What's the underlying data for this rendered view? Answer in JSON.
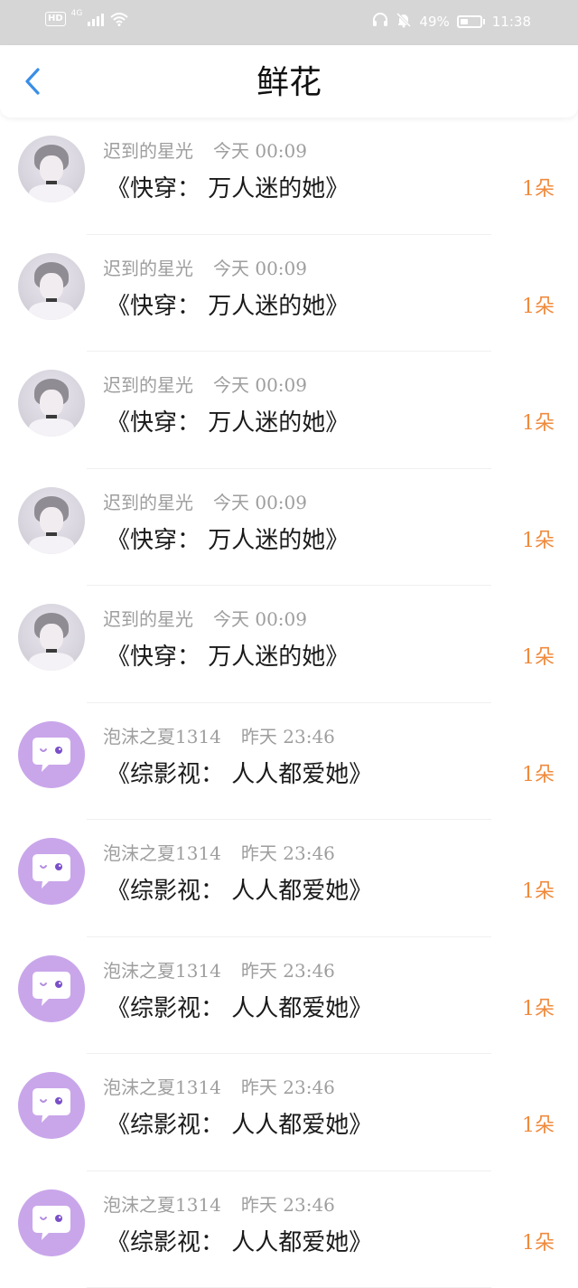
{
  "status_bar": {
    "hd": "HD",
    "network": "4G",
    "battery_percent": "49%",
    "battery_level": 0.49,
    "time": "11:38",
    "icons": [
      "signal-icon",
      "wifi-icon",
      "headphones-icon",
      "mute-bell-icon",
      "battery-icon"
    ]
  },
  "nav": {
    "back_icon": "chevron-left-icon",
    "title": "鲜花"
  },
  "colors": {
    "status_bar_bg": "#d6d6d6",
    "back_arrow": "#3a8ee6",
    "count_accent": "#f08a3c",
    "chat_avatar_bg": "#c9a6ea",
    "meta_text": "#9e9e9e"
  },
  "items": [
    {
      "avatar": "photo-avatar",
      "user": "迟到的星光",
      "time": "今天 00:09",
      "title": "《快穿： 万人迷的她》",
      "count": "1朵"
    },
    {
      "avatar": "photo-avatar",
      "user": "迟到的星光",
      "time": "今天 00:09",
      "title": "《快穿： 万人迷的她》",
      "count": "1朵"
    },
    {
      "avatar": "photo-avatar",
      "user": "迟到的星光",
      "time": "今天 00:09",
      "title": "《快穿： 万人迷的她》",
      "count": "1朵"
    },
    {
      "avatar": "photo-avatar",
      "user": "迟到的星光",
      "time": "今天 00:09",
      "title": "《快穿： 万人迷的她》",
      "count": "1朵"
    },
    {
      "avatar": "photo-avatar",
      "user": "迟到的星光",
      "time": "今天 00:09",
      "title": "《快穿： 万人迷的她》",
      "count": "1朵"
    },
    {
      "avatar": "chat-bubble-avatar",
      "user": "泡沫之夏1314",
      "time": "昨天 23:46",
      "title": "《综影视： 人人都爱她》",
      "count": "1朵"
    },
    {
      "avatar": "chat-bubble-avatar",
      "user": "泡沫之夏1314",
      "time": "昨天 23:46",
      "title": "《综影视： 人人都爱她》",
      "count": "1朵"
    },
    {
      "avatar": "chat-bubble-avatar",
      "user": "泡沫之夏1314",
      "time": "昨天 23:46",
      "title": "《综影视： 人人都爱她》",
      "count": "1朵"
    },
    {
      "avatar": "chat-bubble-avatar",
      "user": "泡沫之夏1314",
      "time": "昨天 23:46",
      "title": "《综影视： 人人都爱她》",
      "count": "1朵"
    },
    {
      "avatar": "chat-bubble-avatar",
      "user": "泡沫之夏1314",
      "time": "昨天 23:46",
      "title": "《综影视： 人人都爱她》",
      "count": "1朵"
    }
  ]
}
